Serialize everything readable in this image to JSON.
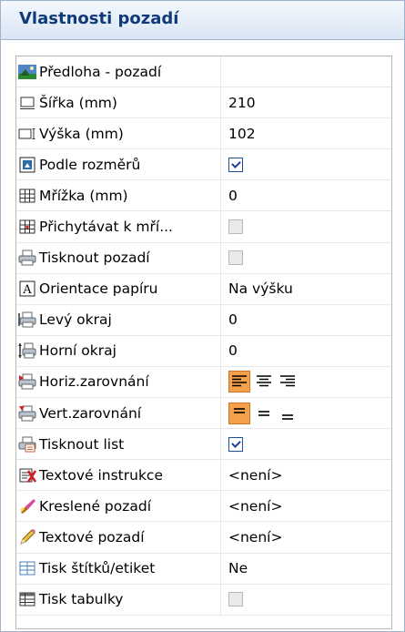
{
  "panel": {
    "title": "Vlastnosti pozadí"
  },
  "rows": [
    {
      "label": "Předloha - pozadí",
      "value": ""
    },
    {
      "label": "Šířka (mm)",
      "value": "210"
    },
    {
      "label": "Výška (mm)",
      "value": "102"
    },
    {
      "label": "Podle rozměrů",
      "checked": true
    },
    {
      "label": "Mřížka (mm)",
      "value": "0"
    },
    {
      "label": "Přichytávat k mří...",
      "checked": false
    },
    {
      "label": "Tisknout pozadí",
      "checked": false
    },
    {
      "label": "Orientace papíru",
      "value": "Na výšku"
    },
    {
      "label": "Levý okraj",
      "value": "0"
    },
    {
      "label": "Horní okraj",
      "value": "0"
    },
    {
      "label": "Horiz.zarovnání",
      "selected": "left"
    },
    {
      "label": "Vert.zarovnání",
      "selected": "top"
    },
    {
      "label": "Tisknout list",
      "checked": true
    },
    {
      "label": "Textové instrukce",
      "value": "<není>"
    },
    {
      "label": "Kreslené pozadí",
      "value": "<není>"
    },
    {
      "label": "Textové pozadí",
      "value": "<není>"
    },
    {
      "label": "Tisk štítků/etiket",
      "value": "Ne"
    },
    {
      "label": "Tisk tabulky",
      "checked": false
    }
  ]
}
